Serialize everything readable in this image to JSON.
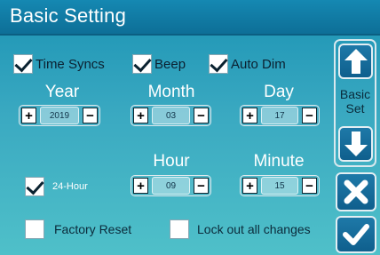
{
  "title": "Basic Setting",
  "options": {
    "time_syncs": {
      "label": "Time Syncs",
      "checked": true
    },
    "beep": {
      "label": "Beep",
      "checked": true
    },
    "auto_dim": {
      "label": "Auto Dim",
      "checked": true
    },
    "hour24": {
      "label": "24-Hour",
      "checked": true
    },
    "factory_reset": {
      "label": "Factory Reset",
      "checked": false
    },
    "lock_out": {
      "label": "Lock out all changes",
      "checked": false
    }
  },
  "date": {
    "year": {
      "label": "Year",
      "value": "2019"
    },
    "month": {
      "label": "Month",
      "value": "03"
    },
    "day": {
      "label": "Day",
      "value": "17"
    }
  },
  "time": {
    "hour": {
      "label": "Hour",
      "value": "09"
    },
    "minute": {
      "label": "Minute",
      "value": "15"
    }
  },
  "stepper": {
    "plus": "+",
    "minus": "−"
  },
  "side": {
    "basic_set": "Basic\nSet"
  },
  "icons": {
    "up": "arrow-up-icon",
    "down": "arrow-down-icon",
    "cancel": "close-icon",
    "confirm": "checkmark-icon"
  }
}
